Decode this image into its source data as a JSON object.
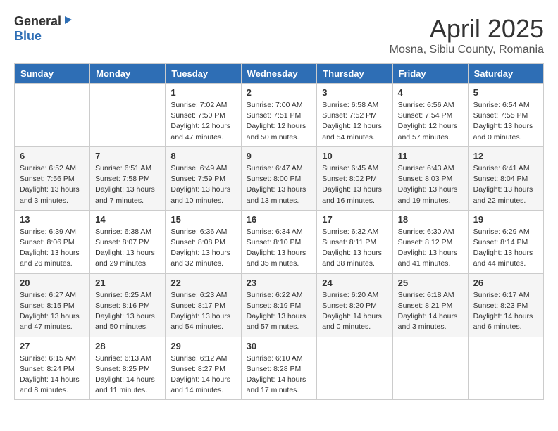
{
  "header": {
    "logo_general": "General",
    "logo_blue": "Blue",
    "month_title": "April 2025",
    "location": "Mosna, Sibiu County, Romania"
  },
  "days_of_week": [
    "Sunday",
    "Monday",
    "Tuesday",
    "Wednesday",
    "Thursday",
    "Friday",
    "Saturday"
  ],
  "weeks": [
    [
      {
        "day": "",
        "info": ""
      },
      {
        "day": "",
        "info": ""
      },
      {
        "day": "1",
        "info": "Sunrise: 7:02 AM\nSunset: 7:50 PM\nDaylight: 12 hours and 47 minutes."
      },
      {
        "day": "2",
        "info": "Sunrise: 7:00 AM\nSunset: 7:51 PM\nDaylight: 12 hours and 50 minutes."
      },
      {
        "day": "3",
        "info": "Sunrise: 6:58 AM\nSunset: 7:52 PM\nDaylight: 12 hours and 54 minutes."
      },
      {
        "day": "4",
        "info": "Sunrise: 6:56 AM\nSunset: 7:54 PM\nDaylight: 12 hours and 57 minutes."
      },
      {
        "day": "5",
        "info": "Sunrise: 6:54 AM\nSunset: 7:55 PM\nDaylight: 13 hours and 0 minutes."
      }
    ],
    [
      {
        "day": "6",
        "info": "Sunrise: 6:52 AM\nSunset: 7:56 PM\nDaylight: 13 hours and 3 minutes."
      },
      {
        "day": "7",
        "info": "Sunrise: 6:51 AM\nSunset: 7:58 PM\nDaylight: 13 hours and 7 minutes."
      },
      {
        "day": "8",
        "info": "Sunrise: 6:49 AM\nSunset: 7:59 PM\nDaylight: 13 hours and 10 minutes."
      },
      {
        "day": "9",
        "info": "Sunrise: 6:47 AM\nSunset: 8:00 PM\nDaylight: 13 hours and 13 minutes."
      },
      {
        "day": "10",
        "info": "Sunrise: 6:45 AM\nSunset: 8:02 PM\nDaylight: 13 hours and 16 minutes."
      },
      {
        "day": "11",
        "info": "Sunrise: 6:43 AM\nSunset: 8:03 PM\nDaylight: 13 hours and 19 minutes."
      },
      {
        "day": "12",
        "info": "Sunrise: 6:41 AM\nSunset: 8:04 PM\nDaylight: 13 hours and 22 minutes."
      }
    ],
    [
      {
        "day": "13",
        "info": "Sunrise: 6:39 AM\nSunset: 8:06 PM\nDaylight: 13 hours and 26 minutes."
      },
      {
        "day": "14",
        "info": "Sunrise: 6:38 AM\nSunset: 8:07 PM\nDaylight: 13 hours and 29 minutes."
      },
      {
        "day": "15",
        "info": "Sunrise: 6:36 AM\nSunset: 8:08 PM\nDaylight: 13 hours and 32 minutes."
      },
      {
        "day": "16",
        "info": "Sunrise: 6:34 AM\nSunset: 8:10 PM\nDaylight: 13 hours and 35 minutes."
      },
      {
        "day": "17",
        "info": "Sunrise: 6:32 AM\nSunset: 8:11 PM\nDaylight: 13 hours and 38 minutes."
      },
      {
        "day": "18",
        "info": "Sunrise: 6:30 AM\nSunset: 8:12 PM\nDaylight: 13 hours and 41 minutes."
      },
      {
        "day": "19",
        "info": "Sunrise: 6:29 AM\nSunset: 8:14 PM\nDaylight: 13 hours and 44 minutes."
      }
    ],
    [
      {
        "day": "20",
        "info": "Sunrise: 6:27 AM\nSunset: 8:15 PM\nDaylight: 13 hours and 47 minutes."
      },
      {
        "day": "21",
        "info": "Sunrise: 6:25 AM\nSunset: 8:16 PM\nDaylight: 13 hours and 50 minutes."
      },
      {
        "day": "22",
        "info": "Sunrise: 6:23 AM\nSunset: 8:17 PM\nDaylight: 13 hours and 54 minutes."
      },
      {
        "day": "23",
        "info": "Sunrise: 6:22 AM\nSunset: 8:19 PM\nDaylight: 13 hours and 57 minutes."
      },
      {
        "day": "24",
        "info": "Sunrise: 6:20 AM\nSunset: 8:20 PM\nDaylight: 14 hours and 0 minutes."
      },
      {
        "day": "25",
        "info": "Sunrise: 6:18 AM\nSunset: 8:21 PM\nDaylight: 14 hours and 3 minutes."
      },
      {
        "day": "26",
        "info": "Sunrise: 6:17 AM\nSunset: 8:23 PM\nDaylight: 14 hours and 6 minutes."
      }
    ],
    [
      {
        "day": "27",
        "info": "Sunrise: 6:15 AM\nSunset: 8:24 PM\nDaylight: 14 hours and 8 minutes."
      },
      {
        "day": "28",
        "info": "Sunrise: 6:13 AM\nSunset: 8:25 PM\nDaylight: 14 hours and 11 minutes."
      },
      {
        "day": "29",
        "info": "Sunrise: 6:12 AM\nSunset: 8:27 PM\nDaylight: 14 hours and 14 minutes."
      },
      {
        "day": "30",
        "info": "Sunrise: 6:10 AM\nSunset: 8:28 PM\nDaylight: 14 hours and 17 minutes."
      },
      {
        "day": "",
        "info": ""
      },
      {
        "day": "",
        "info": ""
      },
      {
        "day": "",
        "info": ""
      }
    ]
  ]
}
